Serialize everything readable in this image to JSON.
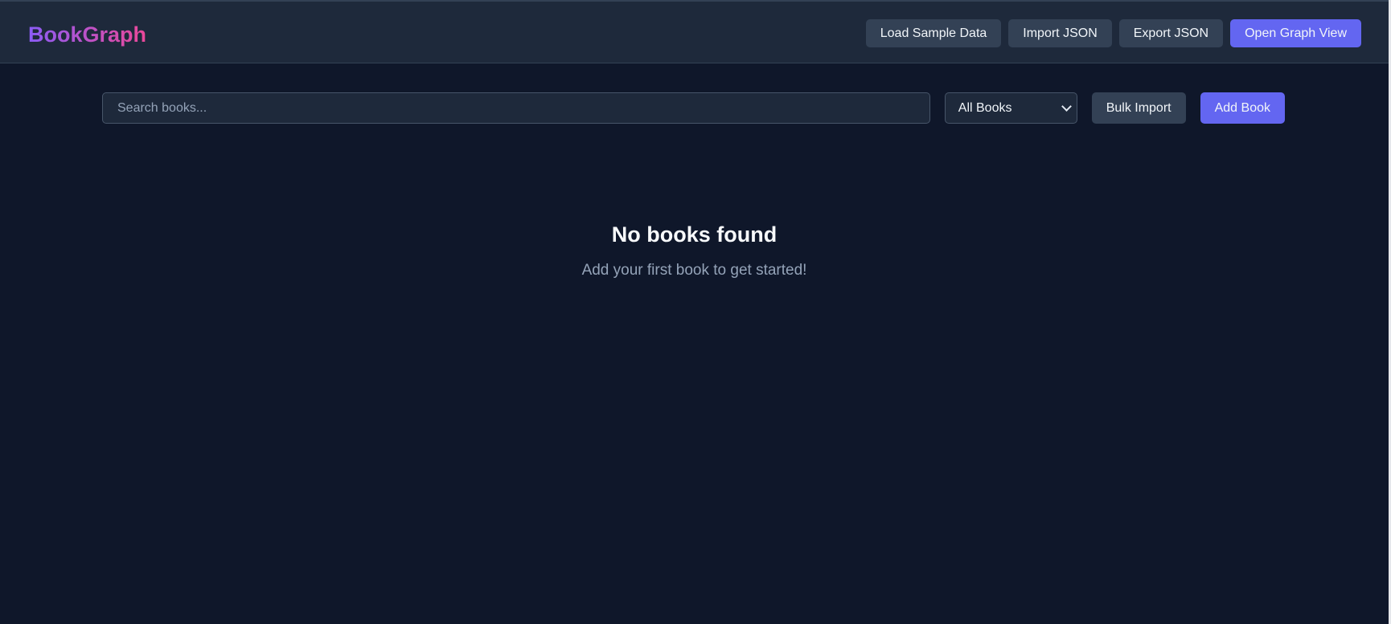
{
  "app": {
    "logo": "BookGraph"
  },
  "header": {
    "buttons": [
      {
        "label": "Load Sample Data"
      },
      {
        "label": "Import JSON"
      },
      {
        "label": "Export JSON"
      },
      {
        "label": "Open Graph View"
      }
    ]
  },
  "toolbar": {
    "search": {
      "placeholder": "Search books...",
      "value": ""
    },
    "filter": {
      "selected": "All Books"
    },
    "bulk_import_label": "Bulk Import",
    "add_book_label": "Add Book"
  },
  "empty_state": {
    "title": "No books found",
    "subtitle": "Add your first book to get started!"
  },
  "colors": {
    "background": "#0f172a",
    "header": "#1e293b",
    "secondary_button": "#334155",
    "accent": "#6366f1",
    "logo_gradient": [
      "#8b5cf6",
      "#ec4899"
    ]
  },
  "icons": {
    "filter_dropdown": "chevron-down-icon"
  }
}
